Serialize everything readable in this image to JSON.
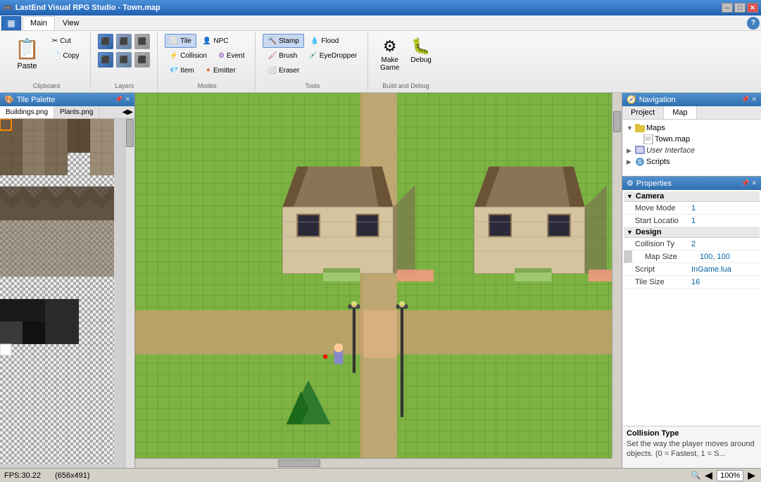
{
  "titlebar": {
    "title": "LastEnd Visual RPG Studio - Town.map",
    "min_label": "─",
    "max_label": "□",
    "close_label": "✕"
  },
  "menubar": {
    "icon": "≡",
    "tabs": [
      "Main",
      "View"
    ],
    "active_tab": "Main",
    "help_label": "?"
  },
  "ribbon": {
    "clipboard_group": {
      "label": "Clipboard",
      "paste_label": "Paste",
      "cut_label": "Cut",
      "copy_label": "Copy"
    },
    "layers_group": {
      "label": "Layers"
    },
    "modes_group": {
      "label": "Modes",
      "tile_label": "Tile",
      "collision_label": "Collision",
      "item_label": "Item",
      "npc_label": "NPC",
      "event_label": "Event",
      "emitter_label": "Emitter"
    },
    "tools_group": {
      "label": "Tools",
      "stamp_label": "Stamp",
      "flood_label": "Flood",
      "brush_label": "Brush",
      "eyedropper_label": "EyeDropper",
      "eraser_label": "Eraser"
    },
    "build_group": {
      "label": "Build and Debug",
      "make_game_label": "Make\nGame",
      "debug_label": "Debug"
    }
  },
  "tile_palette": {
    "title": "Tile Palette",
    "tabs": [
      "Buildings.png",
      "Plants.png"
    ],
    "active_tab": "Buildings.png"
  },
  "navigation": {
    "title": "Navigation",
    "tabs": [
      "Project",
      "Map"
    ],
    "active_tab": "Map",
    "tree": [
      {
        "label": "Maps",
        "level": 0,
        "expandable": true,
        "expanded": true,
        "icon": "folder"
      },
      {
        "label": "Town.map",
        "level": 1,
        "expandable": false,
        "icon": "file"
      },
      {
        "label": "User Interface",
        "level": 0,
        "expandable": true,
        "expanded": false,
        "icon": "ui"
      },
      {
        "label": "Scripts",
        "level": 0,
        "expandable": true,
        "expanded": false,
        "icon": "scripts"
      }
    ]
  },
  "properties": {
    "title": "Properties",
    "sections": [
      {
        "label": "Camera",
        "expanded": true,
        "rows": [
          {
            "name": "Move Mode",
            "value": "1"
          },
          {
            "name": "Start Locatio",
            "value": "1"
          }
        ]
      },
      {
        "label": "Design",
        "expanded": true,
        "rows": [
          {
            "name": "Collision Ty",
            "value": "2"
          },
          {
            "name": "Map Size",
            "value": "100, 100"
          },
          {
            "name": "Script",
            "value": "InGame.lua"
          },
          {
            "name": "Tile Size",
            "value": "16"
          }
        ]
      }
    ],
    "tooltip": {
      "title": "Collision Type",
      "description": "Set the way the player moves around objects. (0 = Fastest, 1 = S..."
    }
  },
  "statusbar": {
    "fps": "FPS:30.22",
    "coords": "(656x491)",
    "zoom": "100%",
    "zoom_icon": "🔍"
  },
  "map": {
    "scrollbar_v_thumb_top": "5%",
    "scrollbar_h_thumb_left": "30%"
  }
}
